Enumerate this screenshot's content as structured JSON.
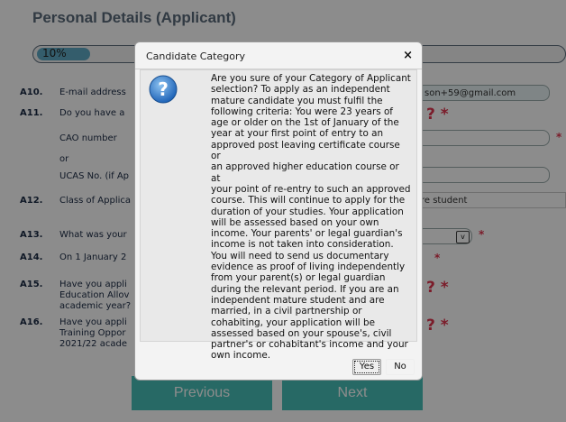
{
  "page": {
    "title": "Personal Details (Applicant)",
    "progress": {
      "label": "10%",
      "value_percent": 10
    }
  },
  "questions": {
    "a10": {
      "num": "A10.",
      "text": "E-mail address",
      "value": "son+59@gmail.com"
    },
    "a11": {
      "num": "A11.",
      "text": "Do you have a",
      "required": "?  *"
    },
    "cao": {
      "label": "CAO number",
      "required": "*"
    },
    "or_label": "or",
    "ucas": {
      "label": "UCAS No. (if Ap"
    },
    "a12": {
      "num": "A12.",
      "text": "Class of Applica",
      "value": "re student"
    },
    "a13": {
      "num": "A13.",
      "text": "What was your",
      "required": "*",
      "arrow": "v"
    },
    "a14": {
      "num": "A14.",
      "text": "On 1 January 2",
      "required": "*"
    },
    "a15": {
      "num": "A15.",
      "text": "Have you appli\nEducation Allov\nacademic year?",
      "required": "?  *"
    },
    "a16": {
      "num": "A16.",
      "text": "Have you appli\nTraining Oppor\n2021/22 acade",
      "required": "?  *"
    }
  },
  "nav": {
    "previous": "Previous",
    "next": "Next"
  },
  "dialog": {
    "title": "Candidate Category",
    "close": "×",
    "message": "Are you sure of your Category of Applicant\nselection? To apply as an independent\nmature candidate you must fulfil the\nfollowing criteria: You were 23 years of\nage or older on the 1st of January of the\nyear at your first point of entry to an\napproved post leaving certificate course or\nan approved higher education course or at\nyour point of re-entry to such an approved\ncourse. This will continue to apply for the\nduration of your studies. Your application\nwill be assessed based on your own\nincome. Your parents' or legal guardian's\nincome is not taken into consideration.\nYou will need to send us documentary\nevidence as proof of living independently\nfrom your parent(s) or legal guardian\nduring the relevant period. If you are an\nindependent mature student and are\nmarried, in a civil partnership or\ncohabiting, your application will be\nassessed based on your spouse's, civil\npartner's or cohabitant's income and your\nown income.",
    "yes": "Yes",
    "no": "No",
    "icon": "help-icon",
    "icon_glyph": "?"
  },
  "colors": {
    "accent": "#48c0b8",
    "required": "#e0334d",
    "progress": "#5fa9c5"
  }
}
